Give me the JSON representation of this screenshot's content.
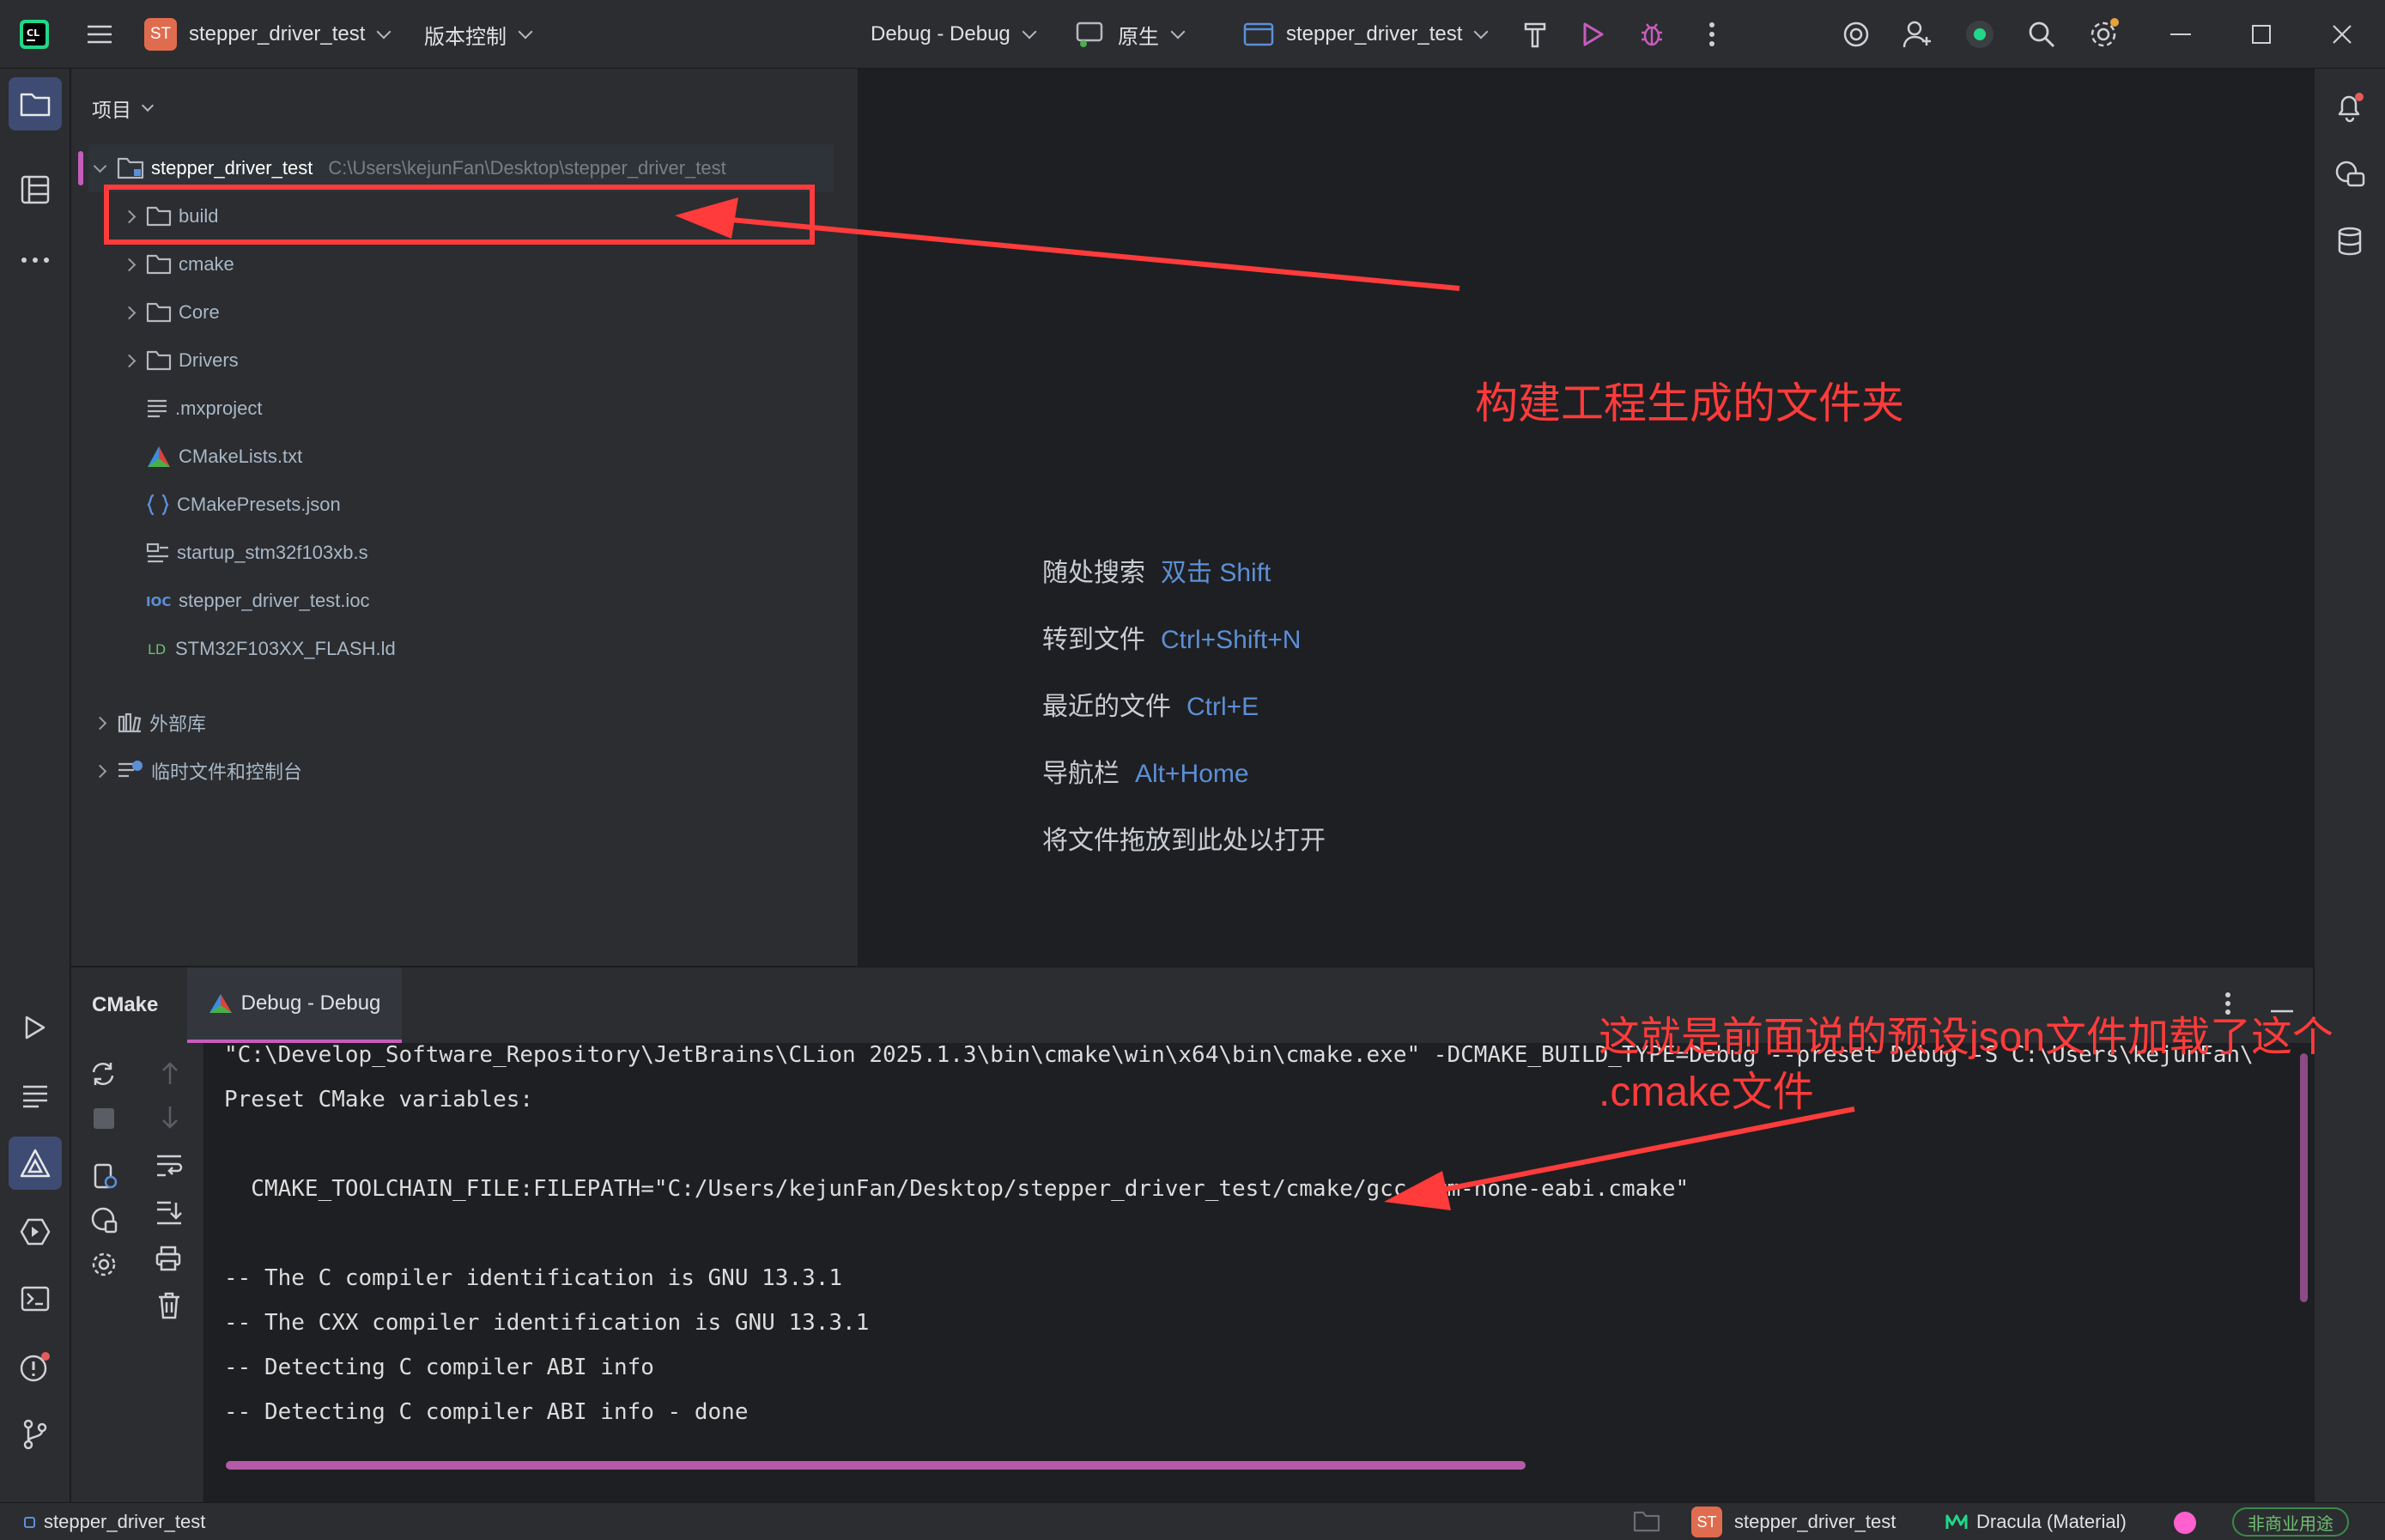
{
  "titlebar": {
    "project_badge": "ST",
    "project_name": "stepper_driver_test",
    "vcs_menu": "版本控制",
    "run_config": "Debug - Debug",
    "toolchain": "原生",
    "target": "stepper_driver_test"
  },
  "left_strip": {
    "tools": [
      "project-icon",
      "structure-icon",
      "more-icon",
      "run-icon",
      "log-icon",
      "cmake-icon",
      "services-icon",
      "terminal-icon",
      "problems-icon",
      "git-icon"
    ]
  },
  "project_panel": {
    "header": "项目",
    "root": {
      "name": "stepper_driver_test",
      "path": "C:\\Users\\kejunFan\\Desktop\\stepper_driver_test"
    },
    "items": [
      {
        "name": "build",
        "kind": "folder",
        "expandable": true
      },
      {
        "name": "cmake",
        "kind": "folder",
        "expandable": true
      },
      {
        "name": "Core",
        "kind": "folder",
        "expandable": true
      },
      {
        "name": "Drivers",
        "kind": "folder",
        "expandable": true
      },
      {
        "name": ".mxproject",
        "kind": "text-file",
        "expandable": false
      },
      {
        "name": "CMakeLists.txt",
        "kind": "cmake-file",
        "expandable": false
      },
      {
        "name": "CMakePresets.json",
        "kind": "json-file",
        "expandable": false
      },
      {
        "name": "startup_stm32f103xb.s",
        "kind": "asm-file",
        "expandable": false
      },
      {
        "name": "stepper_driver_test.ioc",
        "kind": "ioc-file",
        "expandable": false
      },
      {
        "name": "STM32F103XX_FLASH.ld",
        "kind": "ld-file",
        "expandable": false
      }
    ],
    "external_libs": "外部库",
    "scratches": "临时文件和控制台"
  },
  "editor_hints": [
    {
      "label": "随处搜索",
      "key": "双击 Shift"
    },
    {
      "label": "转到文件",
      "key": "Ctrl+Shift+N"
    },
    {
      "label": "最近的文件",
      "key": "Ctrl+E"
    },
    {
      "label": "导航栏",
      "key": "Alt+Home"
    },
    {
      "label": "将文件拖放到此处以打开",
      "key": ""
    }
  ],
  "bottom_panel": {
    "title": "CMake",
    "tab": "Debug - Debug",
    "console": [
      "\"C:\\Develop_Software_Repository\\JetBrains\\CLion 2025.1.3\\bin\\cmake\\win\\x64\\bin\\cmake.exe\" -DCMAKE_BUILD_TYPE=Debug --preset Debug -S C:\\Users\\kejunFan\\",
      "Preset CMake variables:",
      "",
      "  CMAKE_TOOLCHAIN_FILE:FILEPATH=\"C:/Users/kejunFan/Desktop/stepper_driver_test/cmake/gcc-arm-none-eabi.cmake\"",
      "",
      "-- The C compiler identification is GNU 13.3.1",
      "-- The CXX compiler identification is GNU 13.3.1",
      "-- Detecting C compiler ABI info",
      "-- Detecting C compiler ABI info - done"
    ]
  },
  "statusbar": {
    "breadcrumb": "stepper_driver_test",
    "project_badge": "ST",
    "project_name": "stepper_driver_test",
    "theme": "Dracula (Material)",
    "license": "非商业用途"
  },
  "annotations": {
    "build_note": "构建工程生成的文件夹",
    "cmake_note_line1": "这就是前面说的预设json文件加载了这个",
    "cmake_note_line2": ".cmake文件"
  },
  "colors": {
    "accent": "#c75cbd",
    "annotation": "#ff3b3b",
    "hint_key": "#5c8fd6",
    "badge": "#e06c4f"
  }
}
